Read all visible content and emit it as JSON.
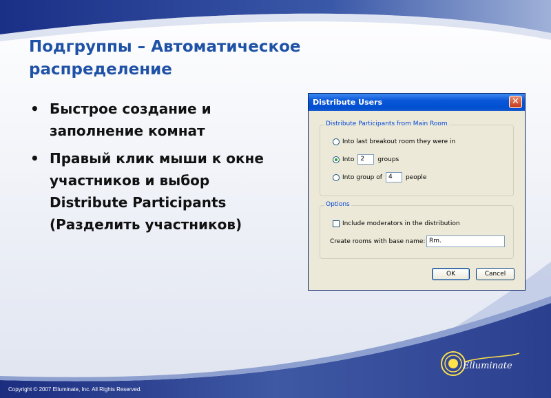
{
  "slide": {
    "title_line1": "Подгруппы – Автоматическое",
    "title_line2": "распределение",
    "bullets": [
      "Быстрое создание и заполнение комнат",
      "Правый клик мыши к окне участников и выбор Distribute Participants (Разделить участников)"
    ],
    "copyright": "Copyright © 2007 Elluminate, Inc. All Rights Reserved.",
    "logo_text": "Elluminate",
    "colors": {
      "title": "#1f52a6",
      "band": "#2a3f93"
    }
  },
  "dialog": {
    "title": "Distribute Users",
    "close_glyph": "✕",
    "distribute_group": {
      "label": "Distribute Participants from Main Room",
      "option1": "Into last breakout room they were in",
      "option2_prefix": "Into",
      "option2_value": "2",
      "option2_suffix": "groups",
      "option3_prefix": "Into group of",
      "option3_value": "4",
      "option3_suffix": "people",
      "selected": "option2"
    },
    "options_group": {
      "label": "Options",
      "include_moderators": "Include moderators in the distribution",
      "include_moderators_checked": false,
      "base_name_label": "Create rooms with base name:",
      "base_name_value": "Rm."
    },
    "ok_label": "OK",
    "cancel_label": "Cancel"
  }
}
